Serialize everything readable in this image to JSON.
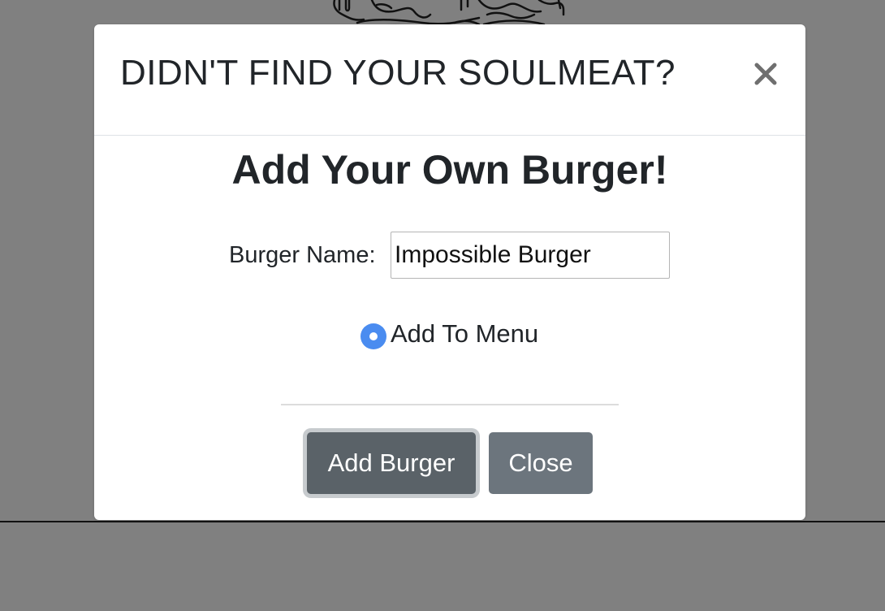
{
  "modal": {
    "title": "DIDN'T FIND YOUR SOULMEAT?",
    "close_icon": "close-icon",
    "heading": "Add Your Own Burger!",
    "form": {
      "name_label": "Burger Name:",
      "name_value": "Impossible Burger",
      "radio_label": "Add To Menu",
      "radio_checked": true
    },
    "buttons": {
      "add_label": "Add Burger",
      "close_label": "Close"
    }
  },
  "colors": {
    "backdrop": "#808080",
    "radio_accent": "#4a8cf0",
    "add_button": "#5a6268",
    "close_button": "#6c757d",
    "text": "#212529"
  }
}
